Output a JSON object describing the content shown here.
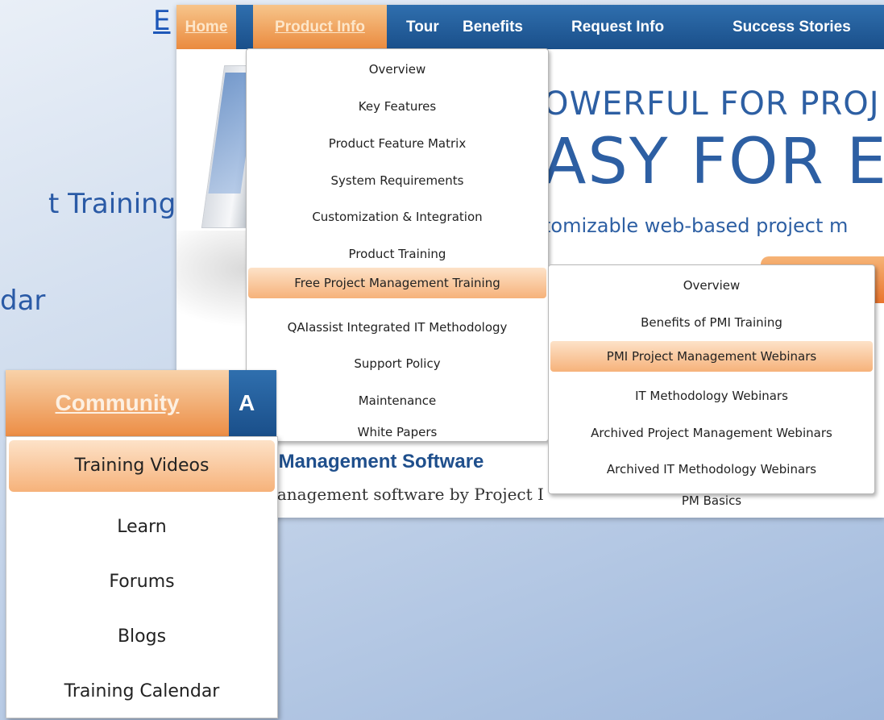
{
  "slide_bg": {
    "link_fragment": "E",
    "line1": "t Training",
    "line2": "dar"
  },
  "nav": {
    "items": [
      {
        "label": "Home",
        "active": true
      },
      {
        "label": "Product Info",
        "active": true
      },
      {
        "label": "Tour"
      },
      {
        "label": "Benefits"
      },
      {
        "label": "Request Info"
      },
      {
        "label": "Success Stories"
      }
    ]
  },
  "hero": {
    "line1": "OWERFUL FOR PROJ",
    "line2": "ASY FOR EV",
    "line3": "tomizable web-based project m",
    "heading": "t Management Software",
    "paragraph": "nanagement software by Project I"
  },
  "product_menu": {
    "items": [
      "Overview",
      "Key Features",
      "Product Feature Matrix",
      "System Requirements",
      "Customization & Integration",
      "Product Training",
      "Free Project Management Training",
      "QAIassist Integrated IT Methodology",
      "Support Policy",
      "Maintenance",
      "White Papers"
    ],
    "highlighted_index": 6
  },
  "training_submenu": {
    "items": [
      "Overview",
      "Benefits of PMI Training",
      "PMI Project Management Webinars",
      "IT Methodology Webinars",
      "Archived Project Management Webinars",
      "Archived IT Methodology Webinars",
      "PM Basics"
    ],
    "highlighted_index": 2
  },
  "community": {
    "tab_label": "Community",
    "next_tab_label": "A",
    "items": [
      "Training Videos",
      "Learn",
      "Forums",
      "Blogs",
      "Training Calendar"
    ],
    "highlighted_index": 0
  },
  "colors": {
    "nav_blue": "#1a4f8a",
    "highlight_orange": "#f6b27a",
    "text_blue": "#2d5fa3"
  }
}
